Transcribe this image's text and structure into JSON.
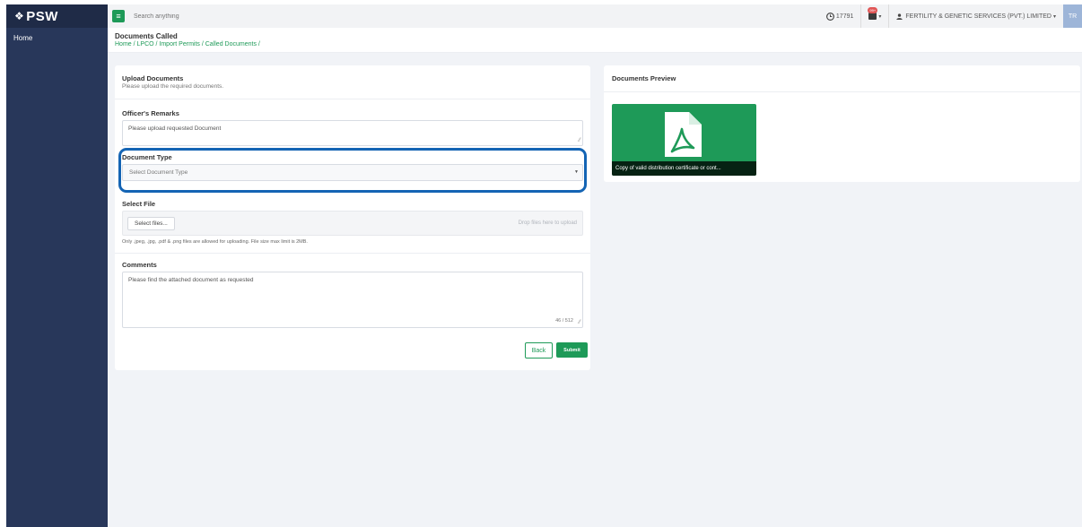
{
  "brand": {
    "logo_text": "PSW",
    "logo_glyph": "❖"
  },
  "sidebar": {
    "items": [
      {
        "label": "Home"
      }
    ]
  },
  "topbar": {
    "menu_glyph": "≡",
    "search_placeholder": "Search anything",
    "counter_value": "17791",
    "notification_count": "99+",
    "company_name": "FERTILITY & GENETIC SERVICES (PVT.) LIMITED",
    "avatar_initials": "TR",
    "caret": "▾"
  },
  "page": {
    "title": "Documents Called",
    "breadcrumb": "Home / LPCO / Import Permits / Called Documents /"
  },
  "upload_card": {
    "title": "Upload Documents",
    "subtitle": "Please upload the required documents.",
    "officer_remarks": {
      "label": "Officer's Remarks",
      "value": "Please upload requested Document"
    },
    "document_type": {
      "label": "Document Type",
      "placeholder": "Select Document Type"
    },
    "select_file": {
      "label": "Select File",
      "button_label": "Select files...",
      "drop_hint": "Drop files here to upload",
      "note": "Only .jpeg, .jpg, .pdf & .png files are allowed for uploading. File size max limit is 2MB."
    },
    "comments": {
      "label": "Comments",
      "value": "Please find the attached document as requested",
      "counter": "46 / 512"
    },
    "buttons": {
      "back": "Back",
      "submit": "Submit"
    }
  },
  "preview_card": {
    "title": "Documents Preview",
    "tile_caption": "Copy of valid distribution certificate or cont..."
  },
  "colors": {
    "sidebar": "#28375a",
    "accent_green": "#1e9a58",
    "highlight_blue": "#1464b4",
    "content_bg": "#f1f3f7"
  }
}
